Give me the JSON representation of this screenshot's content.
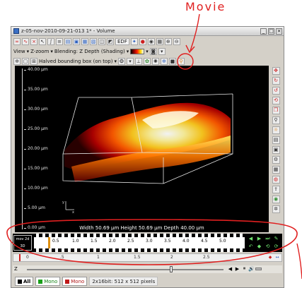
{
  "annotation": {
    "label": "Movie",
    "color": "#e02020"
  },
  "window": {
    "title": "z-05-nov-2010-09-21-013 1* - Volume",
    "controls": [
      "_",
      "□",
      "×"
    ]
  },
  "toolbar": {
    "edf_label": "EDF",
    "view_label": "View",
    "zzoom_label": "Z-zoom",
    "blending_label": "Blending: Z Depth (Shading)",
    "bbox_label": "Halved bounding box (on top)"
  },
  "viewer": {
    "y_ticks": [
      "40.00 µm",
      "35.00 µm",
      "30.00 µm",
      "25.00 µm",
      "20.00 µm",
      "15.00 µm",
      "10.00 µm",
      "5.00 µm",
      "0.00 µm"
    ],
    "dimensions": "Width 50.69 µm Height 50.69 µm Depth 40.00 µm",
    "axis_x": "x",
    "axis_y": "y"
  },
  "filmstrip": {
    "logo_text": "mov 2d 3D",
    "ticks": [
      "0.5",
      "1.0",
      "1.5",
      "2.0",
      "2.5",
      "3.0",
      "3.5",
      "4.0",
      "4.5",
      "5.0"
    ],
    "controls": [
      "◀",
      "▶",
      "⏭",
      "✎",
      "↶",
      "◆",
      "⟲",
      "⟳"
    ]
  },
  "timeline": {
    "ticks": [
      "0",
      ".5",
      "1",
      "1.5",
      "2",
      "2.5"
    ],
    "icons": [
      "◆",
      "↔"
    ]
  },
  "zslider": {
    "label": "Z",
    "controls": [
      "◀",
      "▶",
      "⏸"
    ],
    "volume_icon": "🔊"
  },
  "statusbar": {
    "tabs": [
      {
        "label": "All",
        "color": "#000000"
      },
      {
        "label": "Mono",
        "color": "#1aa01a"
      },
      {
        "label": "Mono",
        "color": "#c01a1a"
      }
    ],
    "info": "2x16bit: 512 x 512 pixels"
  },
  "icons": {
    "movie_button": "movie-camera-icon",
    "right_tools": [
      "arrows-icon",
      "rotate-x-icon",
      "rotate-y-icon",
      "rotate-z-icon",
      "cube-icon",
      "zoom-icon",
      "light-icon",
      "layer-icon",
      "snapshot-icon",
      "gear-icon",
      "grid-icon",
      "sphere-icon",
      "globe-icon",
      "settings-icon"
    ]
  }
}
